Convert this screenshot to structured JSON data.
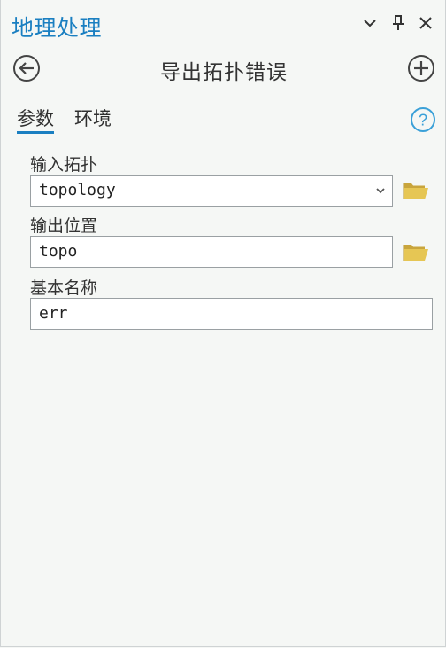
{
  "pane": {
    "title": "地理处理",
    "accent_color": "#1a7fc1",
    "controls": {
      "options_icon": "chevron-down-icon",
      "pin_icon": "pin-icon",
      "close_icon": "close-icon"
    }
  },
  "tool": {
    "title": "导出拓扑错误",
    "back_icon": "back-arrow-icon",
    "add_icon": "add-icon"
  },
  "tabs": [
    {
      "label": "参数",
      "active": true
    },
    {
      "label": "环境",
      "active": false
    }
  ],
  "help_icon": "help-icon",
  "parameters": [
    {
      "label": "输入拓扑",
      "value": "topology",
      "type": "dropdown",
      "browse_icon": "folder-icon"
    },
    {
      "label": "输出位置",
      "value": "topo",
      "type": "text",
      "browse_icon": "folder-icon"
    },
    {
      "label": "基本名称",
      "value": "err",
      "type": "text"
    }
  ]
}
